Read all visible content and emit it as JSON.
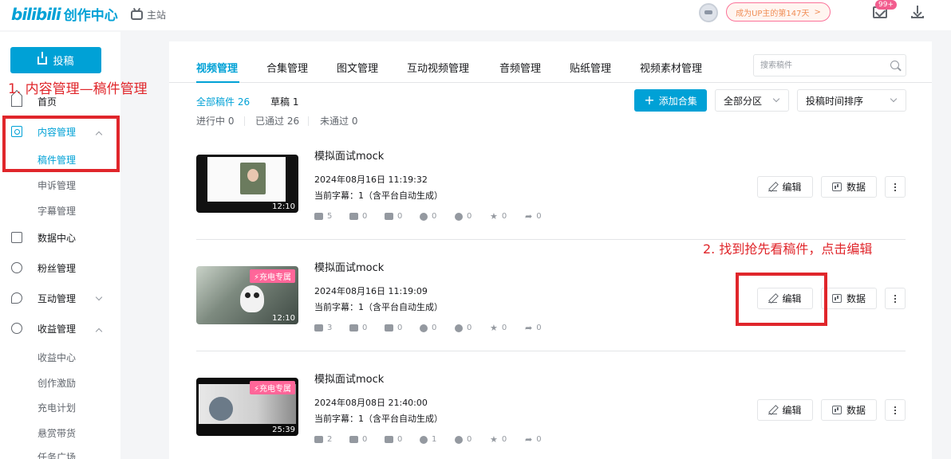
{
  "header": {
    "logo_bili": "bilibili",
    "logo_title": "创作中心",
    "home_link": "主站",
    "up_days": "成为UP主的第147天",
    "up_days_arrow": ">",
    "message_badge": "99+"
  },
  "sidebar": {
    "upload_label": "投稿",
    "items": {
      "home": "首页",
      "content": "内容管理",
      "manuscript": "稿件管理",
      "appeal": "申诉管理",
      "subtitle": "字幕管理",
      "data_center": "数据中心",
      "fans": "粉丝管理",
      "interact": "互动管理",
      "income": "收益管理",
      "income_center": "收益中心",
      "incentive": "创作激励",
      "charge_plan": "充电计划",
      "reward_goods": "悬赏带货",
      "task_square": "任务广场"
    }
  },
  "annotations": {
    "step1": "1. 内容管理—稿件管理",
    "step2": "2. 找到抢先看稿件，点击编辑"
  },
  "tabs": [
    "视频管理",
    "合集管理",
    "图文管理",
    "互动视频管理",
    "音频管理",
    "贴纸管理",
    "视频素材管理"
  ],
  "search": {
    "placeholder": "搜索稿件"
  },
  "filters": {
    "all": "全部稿件 26",
    "draft": "草稿 1",
    "in_progress": "进行中 0",
    "passed": "已通过 26",
    "failed": "未通过 0"
  },
  "toolbar": {
    "add_collection": "添加合集",
    "add_plus": "+",
    "zone_select": "全部分区",
    "sort_select": "投稿时间排序"
  },
  "row_buttons": {
    "edit": "编辑",
    "data": "数据"
  },
  "videos": [
    {
      "title": "模拟面试mock",
      "date": "2024年08月16日 11:19:32",
      "subtitle": "当前字幕：1（含平台自动生成）",
      "duration": "12:10",
      "charge_tag": "",
      "stats": [
        "5",
        "0",
        "0",
        "0",
        "0",
        "0",
        "0"
      ]
    },
    {
      "title": "模拟面试mock",
      "date": "2024年08月16日 11:19:09",
      "subtitle": "当前字幕：1（含平台自动生成）",
      "duration": "12:10",
      "charge_tag": "⚡充电专属",
      "stats": [
        "3",
        "0",
        "0",
        "0",
        "0",
        "0",
        "0"
      ]
    },
    {
      "title": "模拟面试mock",
      "date": "2024年08月08日 21:40:00",
      "subtitle": "当前字幕：1（含平台自动生成）",
      "duration": "25:39",
      "charge_tag": "⚡充电专属",
      "stats": [
        "2",
        "0",
        "0",
        "1",
        "0",
        "0",
        "0"
      ]
    }
  ]
}
